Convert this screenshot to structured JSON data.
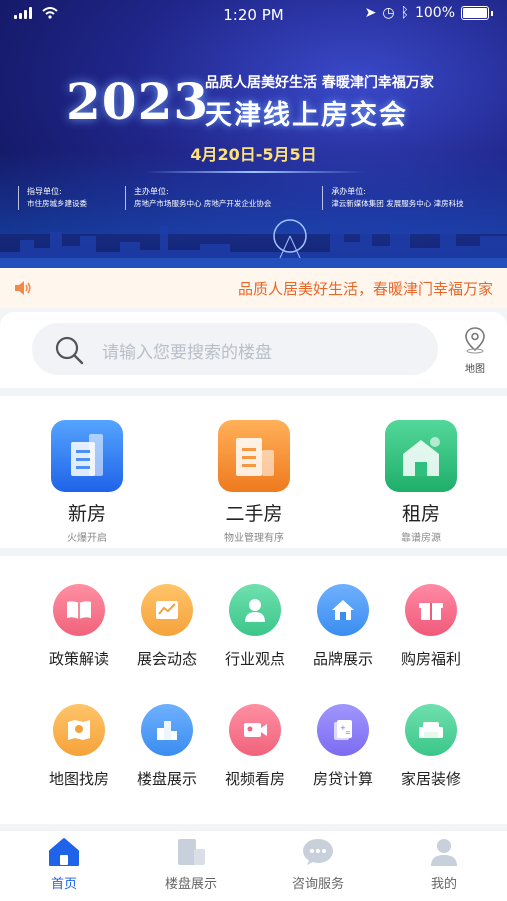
{
  "status_bar": {
    "time": "1:20 PM",
    "battery": "100%"
  },
  "banner": {
    "year": "2023",
    "slogan": "品质人居美好生活 春暖津门幸福万家",
    "title": "天津线上房交会",
    "dates": "4月20日-5月5日",
    "orgs": [
      {
        "heading": "指导单位:",
        "names": "市住房城乡建设委"
      },
      {
        "heading": "主办单位:",
        "names": "房地产市场服务中心  房地产开发企业协会"
      },
      {
        "heading": "承办单位:",
        "names": "津云新媒体集团  发展服务中心  津房科技"
      }
    ]
  },
  "marquee": {
    "text": "品质人居美好生活，春暖津门幸福万家"
  },
  "search": {
    "placeholder": "请输入您要搜索的楼盘",
    "map_label": "地图"
  },
  "main_categories": [
    {
      "name": "新房",
      "sub": "火爆开启",
      "color": "#2f7bf0"
    },
    {
      "name": "二手房",
      "sub": "物业管理有序",
      "color": "#f08a2a"
    },
    {
      "name": "租房",
      "sub": "靠谱房源",
      "color": "#2fbf7f"
    }
  ],
  "grid_items": [
    {
      "label": "政策解读",
      "icon": "book-icon",
      "color": "#f0637c"
    },
    {
      "label": "展会动态",
      "icon": "chart-icon",
      "color": "#f5a23a"
    },
    {
      "label": "行业观点",
      "icon": "person-icon",
      "color": "#3cc68a"
    },
    {
      "label": "品牌展示",
      "icon": "house-icon",
      "color": "#3a8df0"
    },
    {
      "label": "购房福利",
      "icon": "gift-icon",
      "color": "#f05a7a"
    },
    {
      "label": "地图找房",
      "icon": "map-icon",
      "color": "#f5a23a"
    },
    {
      "label": "楼盘展示",
      "icon": "buildings-icon",
      "color": "#3a8df0"
    },
    {
      "label": "视频看房",
      "icon": "video-icon",
      "color": "#f0637c"
    },
    {
      "label": "房贷计算",
      "icon": "calculator-icon",
      "color": "#7b6cf0"
    },
    {
      "label": "家居装修",
      "icon": "sofa-icon",
      "color": "#3cc68a"
    }
  ],
  "tabs": [
    {
      "label": "首页",
      "icon": "home-icon",
      "active": true
    },
    {
      "label": "楼盘展示",
      "icon": "buildings-icon"
    },
    {
      "label": "咨询服务",
      "icon": "chat-icon"
    },
    {
      "label": "我的",
      "icon": "user-icon"
    }
  ],
  "colors": {
    "accent": "#1f63e8",
    "marquee_text": "#e8672a",
    "banner_bg": "#20268a"
  }
}
